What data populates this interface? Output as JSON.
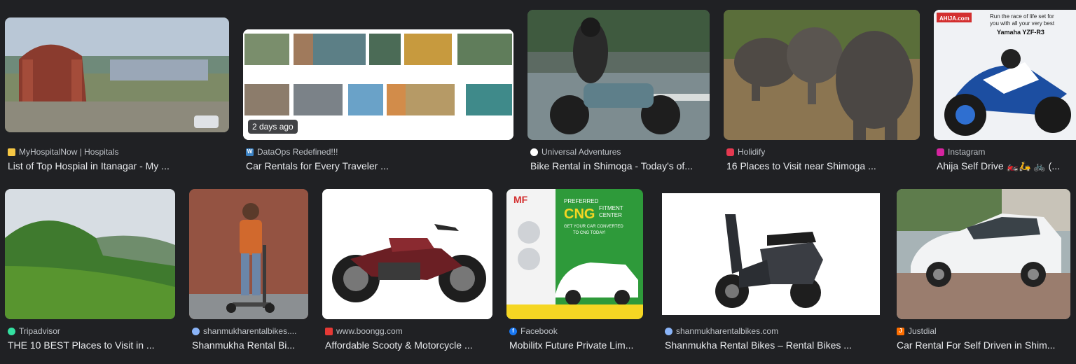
{
  "results": [
    {
      "source": "MyHospitalNow | Hospitals",
      "title": "List of Top Hospial in Itanagar - My ...",
      "favicon": "myhospitalnow-icon",
      "fav_color": "#f6c744"
    },
    {
      "source": "DataOps Redefined!!!",
      "title": "Car Rentals for Every Traveler ...",
      "favicon": "wordpress-icon",
      "fav_color": "#3b82c4",
      "badge": "2 days ago"
    },
    {
      "source": "Universal Adventures",
      "title": "Bike Rental in Shimoga - Today's of...",
      "favicon": "universal-adventures-icon",
      "fav_color": "#ffffff"
    },
    {
      "source": "Holidify",
      "title": "16 Places to Visit near Shimoga ...",
      "favicon": "holidify-icon",
      "fav_color": "#e53950"
    },
    {
      "source": "Instagram",
      "title": "Ahija Self Drive 🏍️🛵 🚲 (...",
      "favicon": "instagram-icon",
      "fav_color": "#d6249f"
    },
    {
      "source": "Tripadvisor",
      "title": "THE 10 BEST Places to Visit in ...",
      "favicon": "tripadvisor-icon",
      "fav_color": "#34e0a1"
    },
    {
      "source": "shanmukharentalbikes....",
      "title": "Shanmukha Rental Bi...",
      "favicon": "globe-icon",
      "fav_color": "#8ab4f8"
    },
    {
      "source": "www.boongg.com",
      "title": "Affordable Scooty & Motorcycle ...",
      "favicon": "boongg-icon",
      "fav_color": "#e53935"
    },
    {
      "source": "Facebook",
      "title": "Mobilitx Future Private Lim...",
      "favicon": "facebook-icon",
      "fav_color": "#1877f2"
    },
    {
      "source": "shanmukharentalbikes.com",
      "title": "Shanmukha Rental Bikes – Rental Bikes ...",
      "favicon": "globe-icon",
      "fav_color": "#8ab4f8"
    },
    {
      "source": "Justdial",
      "title": "Car Rental For Self Driven in Shim...",
      "favicon": "justdial-icon",
      "fav_color": "#ff6f00"
    }
  ],
  "thumb_text": {
    "ad_brand": "AHIJA.com",
    "ad_line1": "Run the race of life set for",
    "ad_line2": "you with all your very best",
    "ad_model": "Yamaha YZF-R3",
    "cng_preferred": "PREFERRED",
    "cng_big": "CNG",
    "cng_fitment": "FITMENT",
    "cng_center": "CENTER",
    "cng_sub1": "GET YOUR CAR CONVERTED",
    "cng_sub2": "TO CNG TODAY!",
    "mf_logo": "MF"
  }
}
